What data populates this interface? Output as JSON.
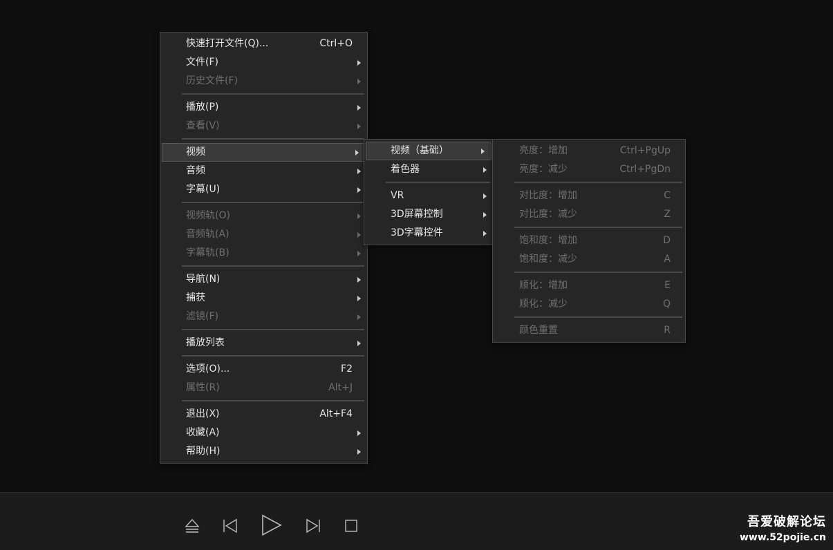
{
  "main_menu": {
    "quick_open": {
      "label": "快速打开文件(Q)...",
      "shortcut": "Ctrl+O"
    },
    "file": "文件(F)",
    "history": "历史文件(F)",
    "play": "播放(P)",
    "view": "查看(V)",
    "video": "视频",
    "audio": "音频",
    "subtitle": "字幕(U)",
    "video_track": "视频轨(O)",
    "audio_track": "音频轨(A)",
    "subtitle_track": "字幕轨(B)",
    "navigate": "导航(N)",
    "capture": "捕获",
    "filter": "滤镜(F)",
    "playlist": "播放列表",
    "options": {
      "label": "选项(O)...",
      "shortcut": "F2"
    },
    "properties": {
      "label": "属性(R)",
      "shortcut": "Alt+J"
    },
    "exit": {
      "label": "退出(X)",
      "shortcut": "Alt+F4"
    },
    "favorites": "收藏(A)",
    "help": "帮助(H)"
  },
  "video_menu": {
    "basic": "视频（基础）",
    "shader": "着色器",
    "vr": "VR",
    "screen3d": "3D屏幕控制",
    "subtitle3d": "3D字幕控件"
  },
  "basic_menu": {
    "brightness_up": {
      "label": "亮度：增加",
      "shortcut": "Ctrl+PgUp"
    },
    "brightness_down": {
      "label": "亮度：减少",
      "shortcut": "Ctrl+PgDn"
    },
    "contrast_up": {
      "label": "对比度：增加",
      "shortcut": "C"
    },
    "contrast_down": {
      "label": "对比度：减少",
      "shortcut": "Z"
    },
    "saturation_up": {
      "label": "饱和度：增加",
      "shortcut": "D"
    },
    "saturation_down": {
      "label": "饱和度：减少",
      "shortcut": "A"
    },
    "smooth_up": {
      "label": "顺化：增加",
      "shortcut": "E"
    },
    "smooth_down": {
      "label": "顺化：减少",
      "shortcut": "Q"
    },
    "color_reset": {
      "label": "颜色重置",
      "shortcut": "R"
    }
  },
  "controls": {
    "icons": [
      "eject-icon",
      "previous-icon",
      "play-icon",
      "next-icon",
      "stop-icon"
    ]
  },
  "watermark": {
    "title": "吾爱破解论坛",
    "url": "www.52pojie.cn"
  },
  "colors": {
    "background": "#0e0e0e",
    "menu_bg": "#262626",
    "menu_border": "#4a4a4a",
    "highlight_bg": "#3a3a3a",
    "text": "#e6e6e6",
    "disabled_text": "#707070"
  }
}
